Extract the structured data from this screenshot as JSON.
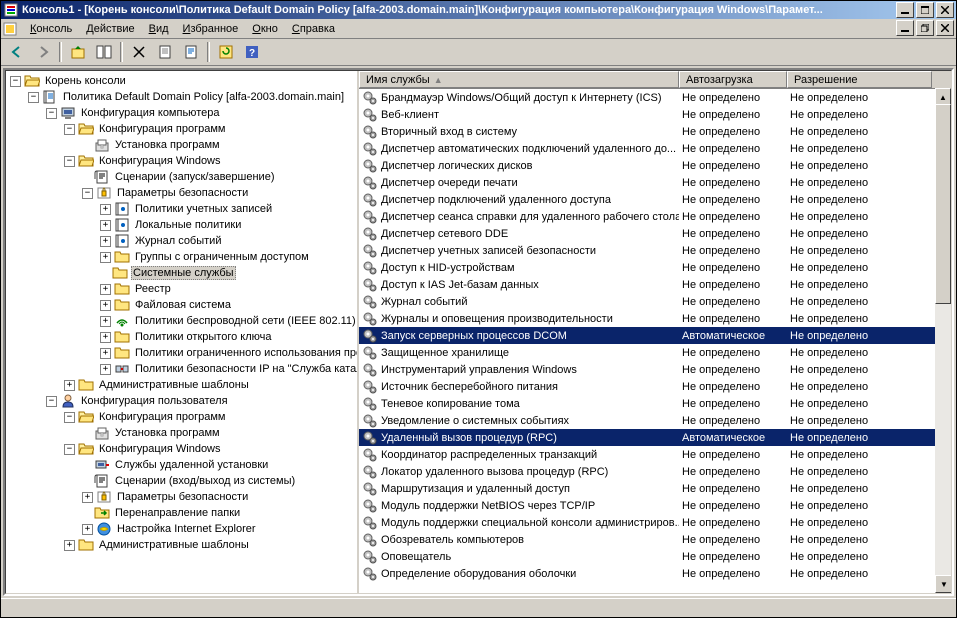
{
  "title": "Консоль1 - [Корень консоли\\Политика Default Domain Policy [alfa-2003.domain.main]\\Конфигурация компьютера\\Конфигурация Windows\\Парамет...",
  "menu": {
    "console": "Консоль",
    "action": "Действие",
    "view": "Вид",
    "favorites": "Избранное",
    "window": "Окно",
    "help": "Справка"
  },
  "col": {
    "name": "Имя службы",
    "startup": "Автозагрузка",
    "perm": "Разрешение"
  },
  "col_widths": {
    "name": 320,
    "startup": 108,
    "perm": 145
  },
  "tree": [
    {
      "ind": 0,
      "exp": "-",
      "icon": "folder",
      "label": "Корень консоли"
    },
    {
      "ind": 1,
      "exp": "-",
      "icon": "policy",
      "label": "Политика Default Domain Policy [alfa-2003.domain.main]"
    },
    {
      "ind": 2,
      "exp": "-",
      "icon": "computer",
      "label": "Конфигурация компьютера"
    },
    {
      "ind": 3,
      "exp": "-",
      "icon": "folder",
      "label": "Конфигурация программ"
    },
    {
      "ind": 4,
      "exp": "",
      "icon": "install",
      "label": "Установка программ"
    },
    {
      "ind": 3,
      "exp": "-",
      "icon": "folder",
      "label": "Конфигурация Windows"
    },
    {
      "ind": 4,
      "exp": "",
      "icon": "script",
      "label": "Сценарии (запуск/завершение)"
    },
    {
      "ind": 4,
      "exp": "-",
      "icon": "security",
      "label": "Параметры безопасности"
    },
    {
      "ind": 5,
      "exp": "+",
      "icon": "policies",
      "label": "Политики учетных записей"
    },
    {
      "ind": 5,
      "exp": "+",
      "icon": "policies",
      "label": "Локальные политики"
    },
    {
      "ind": 5,
      "exp": "+",
      "icon": "policies",
      "label": "Журнал событий"
    },
    {
      "ind": 5,
      "exp": "+",
      "icon": "folder",
      "label": "Группы с ограниченным доступом"
    },
    {
      "ind": 5,
      "exp": "",
      "icon": "folder",
      "label": "Системные службы",
      "sel": true
    },
    {
      "ind": 5,
      "exp": "+",
      "icon": "folder",
      "label": "Реестр"
    },
    {
      "ind": 5,
      "exp": "+",
      "icon": "folder",
      "label": "Файловая система"
    },
    {
      "ind": 5,
      "exp": "+",
      "icon": "wireless",
      "label": "Политики беспроводной сети (IEEE 802.11)"
    },
    {
      "ind": 5,
      "exp": "+",
      "icon": "folder",
      "label": "Политики открытого ключа"
    },
    {
      "ind": 5,
      "exp": "+",
      "icon": "folder",
      "label": "Политики ограниченного использования программ"
    },
    {
      "ind": 5,
      "exp": "+",
      "icon": "ipsec",
      "label": "Политики безопасности IP на \"Служба каталогов\""
    },
    {
      "ind": 3,
      "exp": "+",
      "icon": "folder",
      "label": "Административные шаблоны"
    },
    {
      "ind": 2,
      "exp": "-",
      "icon": "user",
      "label": "Конфигурация пользователя"
    },
    {
      "ind": 3,
      "exp": "-",
      "icon": "folder",
      "label": "Конфигурация программ"
    },
    {
      "ind": 4,
      "exp": "",
      "icon": "install",
      "label": "Установка программ"
    },
    {
      "ind": 3,
      "exp": "-",
      "icon": "folder",
      "label": "Конфигурация Windows"
    },
    {
      "ind": 4,
      "exp": "",
      "icon": "remote",
      "label": "Службы удаленной установки"
    },
    {
      "ind": 4,
      "exp": "",
      "icon": "script",
      "label": "Сценарии (вход/выход из системы)"
    },
    {
      "ind": 4,
      "exp": "+",
      "icon": "security",
      "label": "Параметры безопасности"
    },
    {
      "ind": 4,
      "exp": "",
      "icon": "redirect",
      "label": "Перенаправление папки"
    },
    {
      "ind": 4,
      "exp": "+",
      "icon": "ie",
      "label": "Настройка Internet Explorer"
    },
    {
      "ind": 3,
      "exp": "+",
      "icon": "folder",
      "label": "Административные шаблоны"
    }
  ],
  "services": [
    {
      "name": "Брандмауэр Windows/Общий доступ к Интернету (ICS)",
      "startup": "Не определено",
      "perm": "Не определено"
    },
    {
      "name": "Веб-клиент",
      "startup": "Не определено",
      "perm": "Не определено"
    },
    {
      "name": "Вторичный вход в систему",
      "startup": "Не определено",
      "perm": "Не определено"
    },
    {
      "name": "Диспетчер автоматических подключений удаленного до...",
      "startup": "Не определено",
      "perm": "Не определено"
    },
    {
      "name": "Диспетчер логических дисков",
      "startup": "Не определено",
      "perm": "Не определено"
    },
    {
      "name": "Диспетчер очереди печати",
      "startup": "Не определено",
      "perm": "Не определено"
    },
    {
      "name": "Диспетчер подключений удаленного доступа",
      "startup": "Не определено",
      "perm": "Не определено"
    },
    {
      "name": "Диспетчер сеанса справки для удаленного рабочего стола",
      "startup": "Не определено",
      "perm": "Не определено"
    },
    {
      "name": "Диспетчер сетевого DDE",
      "startup": "Не определено",
      "perm": "Не определено"
    },
    {
      "name": "Диспетчер учетных записей безопасности",
      "startup": "Не определено",
      "perm": "Не определено"
    },
    {
      "name": "Доступ к HID-устройствам",
      "startup": "Не определено",
      "perm": "Не определено"
    },
    {
      "name": "Доступ к IAS Jet-базам данных",
      "startup": "Не определено",
      "perm": "Не определено"
    },
    {
      "name": "Журнал событий",
      "startup": "Не определено",
      "perm": "Не определено"
    },
    {
      "name": "Журналы и оповещения производительности",
      "startup": "Не определено",
      "perm": "Не определено"
    },
    {
      "name": "Запуск серверных процессов DCOM",
      "startup": "Автоматическое",
      "perm": "Не определено",
      "sel": true
    },
    {
      "name": "Защищенное хранилище",
      "startup": "Не определено",
      "perm": "Не определено"
    },
    {
      "name": "Инструментарий управления Windows",
      "startup": "Не определено",
      "perm": "Не определено"
    },
    {
      "name": "Источник бесперебойного питания",
      "startup": "Не определено",
      "perm": "Не определено"
    },
    {
      "name": "Теневое копирование тома",
      "startup": "Не определено",
      "perm": "Не определено"
    },
    {
      "name": "Уведомление о системных событиях",
      "startup": "Не определено",
      "perm": "Не определено"
    },
    {
      "name": "Удаленный вызов процедур (RPC)",
      "startup": "Автоматическое",
      "perm": "Не определено",
      "sel": true
    },
    {
      "name": "Координатор распределенных транзакций",
      "startup": "Не определено",
      "perm": "Не определено"
    },
    {
      "name": "Локатор удаленного вызова процедур (RPC)",
      "startup": "Не определено",
      "perm": "Не определено"
    },
    {
      "name": "Маршрутизация и удаленный доступ",
      "startup": "Не определено",
      "perm": "Не определено"
    },
    {
      "name": "Модуль поддержки NetBIOS через TCP/IP",
      "startup": "Не определено",
      "perm": "Не определено"
    },
    {
      "name": "Модуль поддержки специальной консоли администриров...",
      "startup": "Не определено",
      "perm": "Не определено"
    },
    {
      "name": "Обозреватель компьютеров",
      "startup": "Не определено",
      "perm": "Не определено"
    },
    {
      "name": "Оповещатель",
      "startup": "Не определено",
      "perm": "Не определено"
    },
    {
      "name": "Определение оборудования оболочки",
      "startup": "Не определено",
      "perm": "Не определено"
    }
  ]
}
